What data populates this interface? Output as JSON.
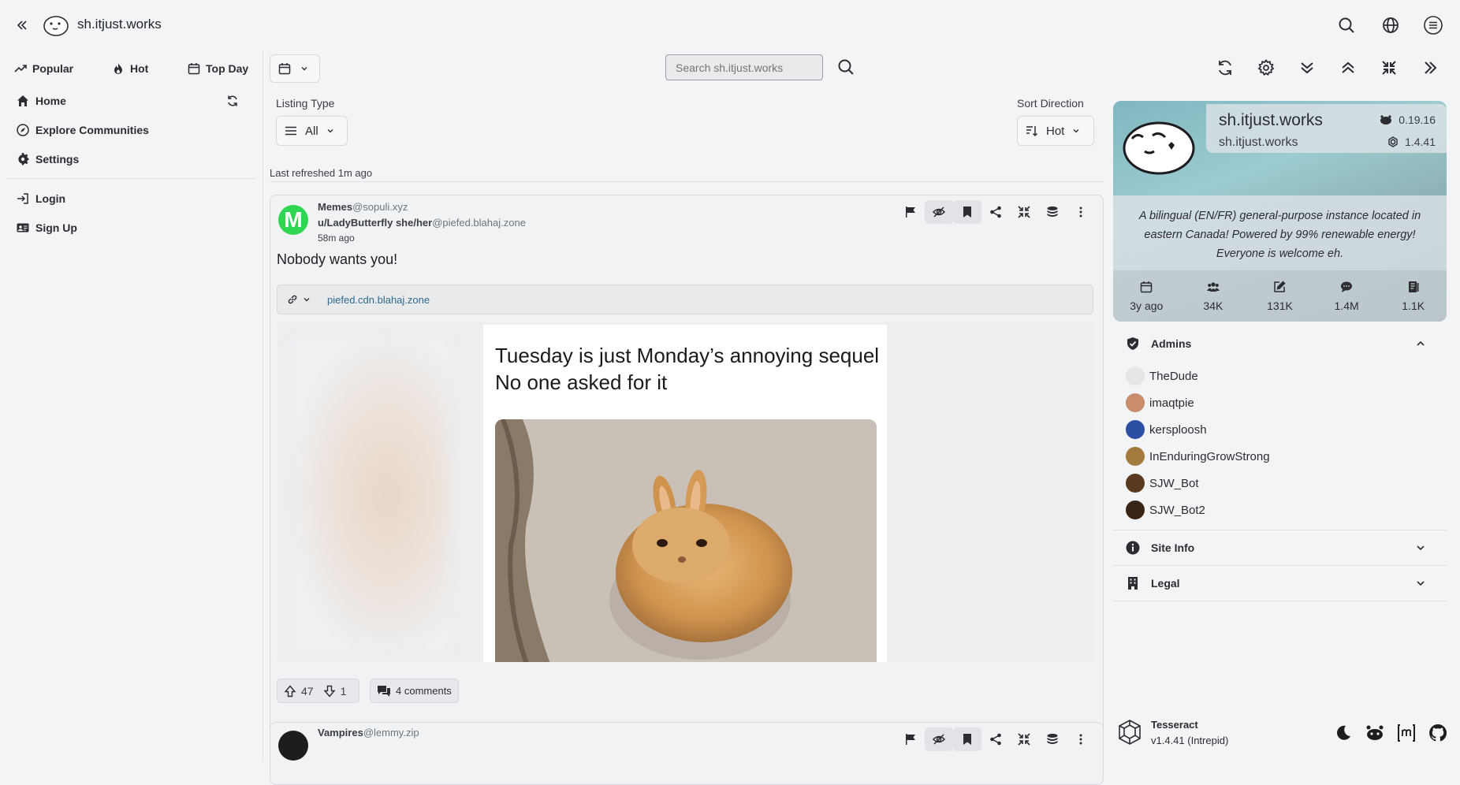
{
  "header": {
    "site_title": "sh.itjust.works"
  },
  "sidebar": {
    "sort_tabs": [
      {
        "label": "Popular",
        "icon": "trending-up-icon"
      },
      {
        "label": "Hot",
        "icon": "flame-icon"
      },
      {
        "label": "Top Day",
        "icon": "calendar-icon"
      }
    ],
    "nav_main": [
      {
        "label": "Home",
        "icon": "home-icon"
      },
      {
        "label": "Explore Communities",
        "icon": "compass-icon"
      },
      {
        "label": "Settings",
        "icon": "gear-icon"
      }
    ],
    "nav_auth": [
      {
        "label": "Login",
        "icon": "login-icon"
      },
      {
        "label": "Sign Up",
        "icon": "id-card-icon"
      }
    ]
  },
  "toolbar": {
    "search_placeholder": "Search sh.itjust.works"
  },
  "filters": {
    "listing_type_label": "Listing Type",
    "listing_type_value": "All",
    "sort_direction_label": "Sort Direction",
    "sort_direction_value": "Hot",
    "last_refreshed": "Last refreshed 1m ago"
  },
  "posts": [
    {
      "community": "Memes",
      "community_instance": "@sopuli.xyz",
      "user": "u/LadyButterfly she/her",
      "user_instance": "@piefed.blahaj.zone",
      "time": "58m ago",
      "title": "Nobody wants you!",
      "link_domain": "piefed.cdn.blahaj.zone",
      "image_text_line1": "Tuesday is just Monday’s annoying sequel",
      "image_text_line2": "No one asked for it",
      "upvotes": "47",
      "downvotes": "1",
      "comments": "4 comments"
    },
    {
      "community": "Vampires",
      "community_instance": "@lemmy.zip"
    }
  ],
  "site_panel": {
    "name": "sh.itjust.works",
    "domain": "sh.itjust.works",
    "lemmy_version": "0.19.16",
    "ui_version": "1.4.41",
    "description": "A bilingual (EN/FR) general-purpose instance located in eastern Canada! Powered by 99% renewable energy! Everyone is welcome eh.",
    "stats": [
      {
        "icon": "calendar-icon",
        "value": "3y ago"
      },
      {
        "icon": "users-icon",
        "value": "34K"
      },
      {
        "icon": "edit-icon",
        "value": "131K"
      },
      {
        "icon": "comment-icon",
        "value": "1.4M"
      },
      {
        "icon": "communities-icon",
        "value": "1.1K"
      }
    ],
    "admins_label": "Admins",
    "admins": [
      {
        "name": "TheDude",
        "color": "#e4e6e8"
      },
      {
        "name": "imaqtpie",
        "color": "#c98d6e"
      },
      {
        "name": "kersploosh",
        "color": "#2d4fa3"
      },
      {
        "name": "InEnduringGrowStrong",
        "color": "#a37b3c"
      },
      {
        "name": "SJW_Bot",
        "color": "#5a3a1e"
      },
      {
        "name": "SJW_Bot2",
        "color": "#3a2514"
      }
    ],
    "site_info_label": "Site Info",
    "legal_label": "Legal"
  },
  "footer": {
    "app_name": "Tesseract",
    "app_version": "v1.4.41 (Intrepid)"
  }
}
